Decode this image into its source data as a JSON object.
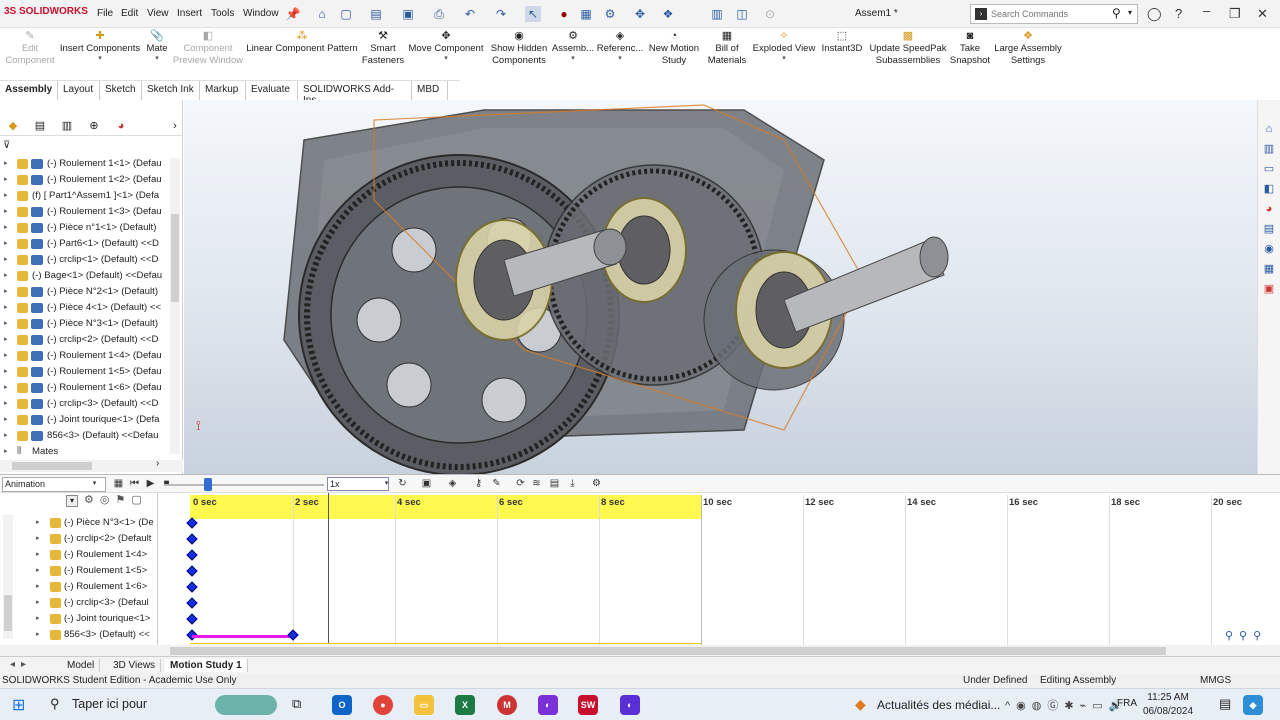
{
  "app": {
    "logo_text": "3S SOLIDWORKS",
    "menu": [
      "File",
      "Edit",
      "View",
      "Insert",
      "Tools",
      "Window"
    ],
    "document_title": "Assem1 *",
    "search_placeholder": "Search Commands"
  },
  "ribbon": [
    {
      "label": "Edit Component",
      "disabled": true
    },
    {
      "label": "Insert Components",
      "disabled": false
    },
    {
      "label": "Mate",
      "disabled": false
    },
    {
      "label": "Component Preview Window",
      "disabled": true
    },
    {
      "label": "Linear Component Pattern",
      "disabled": false
    },
    {
      "label": "Smart Fasteners",
      "disabled": false
    },
    {
      "label": "Move Component",
      "disabled": false
    },
    {
      "label": "Show Hidden Components",
      "disabled": false
    },
    {
      "label": "Assemb...",
      "disabled": false
    },
    {
      "label": "Referenc...",
      "disabled": false
    },
    {
      "label": "New Motion Study",
      "disabled": false
    },
    {
      "label": "Bill of Materials",
      "disabled": false
    },
    {
      "label": "Exploded View",
      "disabled": false
    },
    {
      "label": "Instant3D",
      "disabled": false
    },
    {
      "label": "Update SpeedPak Subassemblies",
      "disabled": false
    },
    {
      "label": "Take Snapshot",
      "disabled": false
    },
    {
      "label": "Large Assembly Settings",
      "disabled": false
    }
  ],
  "tabs": [
    "Assembly",
    "Layout",
    "Sketch",
    "Sketch Ink",
    "Markup",
    "Evaluate",
    "SOLIDWORKS Add-Ins",
    "MBD"
  ],
  "active_tab": "Assembly",
  "feature_tree": [
    "(-) Roulement 1<1> (Defau",
    "(-) Roulement 1<2> (Defau",
    "(f) [ Part1^Assem1 ]<1> (Defa",
    "(-) Roulement 1<3> (Defau",
    "(-) Pièce n°1<1> (Default)",
    "(-) Part6<1> (Default) <<D",
    "(-) crclip<1> (Default) <<D",
    "(-) Bage<1> (Default) <<Defau",
    "(-) Pièce N°2<1> (Default)",
    "(-) Pièce 4<1> (Default) <<",
    "(-) Pièce N°3<1> (Default)",
    "(-) crclip<2> (Default) <<D",
    "(-) Roulement 1<4> (Defau",
    "(-) Roulement 1<5> (Defau",
    "(-) Roulement 1<6> (Defau",
    "(-) crclip<3> (Default) <<D",
    "(-) Joint tourique<1> (Defa",
    "856<3> (Default) <<Defau"
  ],
  "feature_tree_mates": "Mates",
  "motion_study": {
    "type": "Animation",
    "speed": "1x",
    "rows": [
      "(-) Pièce N°3<1> (De",
      "(-) crclip<2> (Default",
      "(-) Roulement 1<4>",
      "(-) Roulement 1<5>",
      "(-) Roulement 1<6>",
      "(-) crclip<3> (Defaul",
      "(-) Joint tourique<1>",
      "856<3> (Default) <<"
    ],
    "ticks": [
      "0 sec",
      "2 sec",
      "4 sec",
      "6 sec",
      "8 sec",
      "10 sec",
      "12 sec",
      "14 sec",
      "16 sec",
      "18 sec",
      "20 sec"
    ],
    "current_time_sec": 2.7,
    "study_length_sec": 10
  },
  "bottom_tabs": [
    "Model",
    "3D Views",
    "Motion Study 1"
  ],
  "status": {
    "left": "SOLIDWORKS Student Edition - Academic Use Only",
    "state": "Under Defined",
    "mode": "Editing Assembly",
    "units": "MMGS"
  },
  "taskbar": {
    "search_text": "Taper ici pour",
    "news": "Actualités des médiai...",
    "language": "FRA",
    "time": "11:25 AM",
    "date": "06/08/2024"
  },
  "colors": {
    "accent": "#2e6fd0",
    "keyframe": "#1530d8",
    "timeline_band": "#fff94f",
    "magenta_bar": "#e617e6"
  }
}
